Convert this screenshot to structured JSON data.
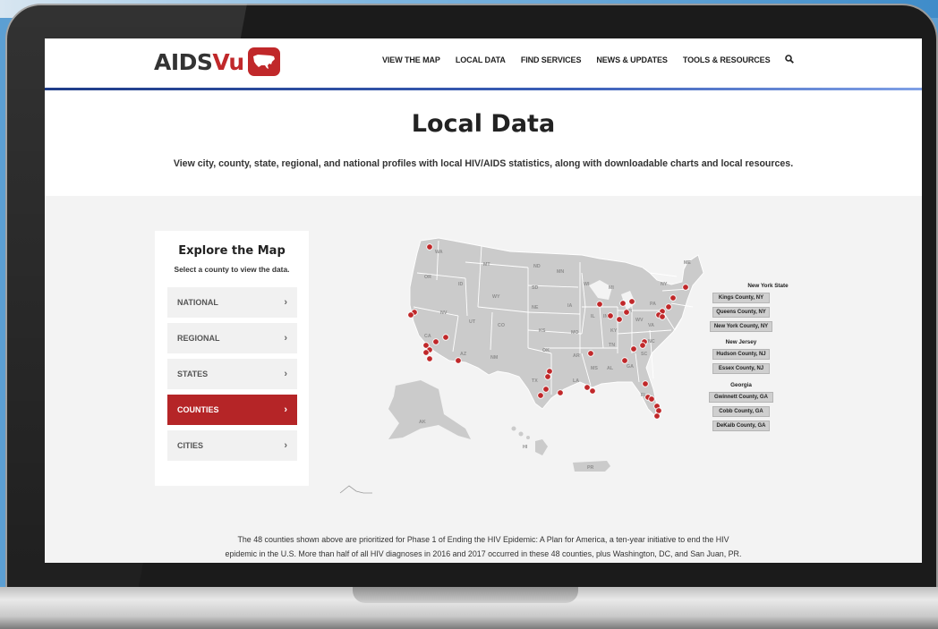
{
  "logo": {
    "main": "AIDS",
    "accent": "Vu",
    "badge_icon": "us-map-icon"
  },
  "nav": [
    "VIEW THE MAP",
    "LOCAL DATA",
    "FIND SERVICES",
    "NEWS & UPDATES",
    "TOOLS & RESOURCES"
  ],
  "nav_search_icon": "search-icon",
  "hero": {
    "title": "Local Data",
    "subtitle": "View city, county, state, regional, and national profiles with local HIV/AIDS statistics, along with downloadable charts and local resources."
  },
  "panel": {
    "title": "Explore the Map",
    "subtitle": "Select a county to view the data.",
    "items": [
      {
        "label": "NATIONAL",
        "chevron": "›"
      },
      {
        "label": "REGIONAL",
        "chevron": "›"
      },
      {
        "label": "STATES",
        "chevron": "›"
      },
      {
        "label": "COUNTIES",
        "chevron": "›",
        "active": true
      },
      {
        "label": "CITIES",
        "chevron": "›"
      }
    ]
  },
  "map_labels": [
    "WA",
    "OR",
    "ID",
    "MT",
    "ND",
    "MN",
    "SD",
    "WY",
    "NV",
    "UT",
    "CO",
    "NE",
    "IA",
    "CA",
    "AZ",
    "NM",
    "KS",
    "MO",
    "IL",
    "OK",
    "TX",
    "AR",
    "LA",
    "MS",
    "AL",
    "GA",
    "TN",
    "KY",
    "SC",
    "NC",
    "VA",
    "WV",
    "PA",
    "NY",
    "OH",
    "MI",
    "WI",
    "ME",
    "IN",
    "FL",
    "AK",
    "HI",
    "PR"
  ],
  "legend": {
    "groups": [
      {
        "heading": "New York State",
        "items": [
          "Kings County, NY",
          "Queens County, NY",
          "New York County, NY"
        ]
      },
      {
        "heading": "New Jersey",
        "items": [
          "Hudson County, NJ",
          "Essex County, NJ"
        ]
      },
      {
        "heading": "Georgia",
        "items": [
          "Gwinnett County, GA",
          "Cobb County, GA",
          "DeKalb County, GA"
        ]
      }
    ]
  },
  "footnote": {
    "line1": "The 48 counties shown above are prioritized for Phase 1 of Ending the HIV Epidemic: A Plan for America, a ten-year initiative to end the HIV",
    "line2": "epidemic in the U.S. More than half of all HIV diagnoses in 2016 and 2017 occurred in these 48 counties, plus Washington, DC, and San Juan, PR."
  },
  "colors": {
    "brand_red": "#c0282a",
    "active_button": "#b52527",
    "map_fill": "#cbcbcb",
    "dot": "#c0282a"
  }
}
